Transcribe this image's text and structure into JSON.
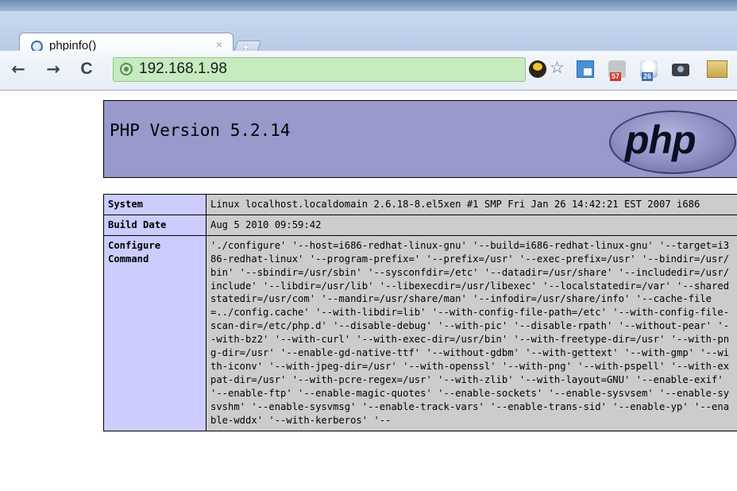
{
  "browser": {
    "tab": {
      "title": "phpinfo()",
      "close": "×"
    },
    "new_tab_label": "+",
    "nav": {
      "back": "←",
      "forward": "→",
      "reload": "C"
    },
    "address_bar": {
      "url": "192.168.1.98",
      "icon": "globe-icon"
    },
    "toolbar_icons": [
      {
        "name": "extension-face-icon"
      },
      {
        "name": "bookmark-star-icon",
        "glyph": "☆"
      },
      {
        "name": "translate-icon"
      },
      {
        "name": "mail-notifier-icon",
        "badge": "57"
      },
      {
        "name": "weather-icon",
        "badge": "26"
      },
      {
        "name": "screenshot-camera-icon"
      },
      {
        "name": "extension-icon"
      }
    ]
  },
  "page": {
    "title": "PHP Version 5.2.14",
    "logo_text": "php",
    "rows": [
      {
        "key": "System",
        "value": "Linux localhost.localdomain 2.6.18-8.el5xen #1 SMP Fri Jan 26 14:42:21 EST 2007 i686"
      },
      {
        "key": "Build Date",
        "value": "Aug 5 2010 09:59:42"
      },
      {
        "key": "Configure Command",
        "value": "'./configure' '--host=i686-redhat-linux-gnu' '--build=i686-redhat-linux-gnu' '--target=i386-redhat-linux' '--program-prefix=' '--prefix=/usr' '--exec-prefix=/usr' '--bindir=/usr/bin' '--sbindir=/usr/sbin' '--sysconfdir=/etc' '--datadir=/usr/share' '--includedir=/usr/include' '--libdir=/usr/lib' '--libexecdir=/usr/libexec' '--localstatedir=/var' '--sharedstatedir=/usr/com' '--mandir=/usr/share/man' '--infodir=/usr/share/info' '--cache-file=../config.cache' '--with-libdir=lib' '--with-config-file-path=/etc' '--with-config-file-scan-dir=/etc/php.d' '--disable-debug' '--with-pic' '--disable-rpath' '--without-pear' '--with-bz2' '--with-curl' '--with-exec-dir=/usr/bin' '--with-freetype-dir=/usr' '--with-png-dir=/usr' '--enable-gd-native-ttf' '--without-gdbm' '--with-gettext' '--with-gmp' '--with-iconv' '--with-jpeg-dir=/usr' '--with-openssl' '--with-png' '--with-pspell' '--with-expat-dir=/usr' '--with-pcre-regex=/usr' '--with-zlib' '--with-layout=GNU' '--enable-exif' '--enable-ftp' '--enable-magic-quotes' '--enable-sockets' '--enable-sysvsem' '--enable-sysvshm' '--enable-sysvmsg' '--enable-track-vars' '--enable-trans-sid' '--enable-yp' '--enable-wddx' '--with-kerberos' '--"
      }
    ]
  },
  "colors": {
    "header_bg": "#9999cc",
    "key_bg": "#ccccff",
    "value_bg": "#cccccc",
    "address_bar_bg": "#c6ebbf"
  }
}
